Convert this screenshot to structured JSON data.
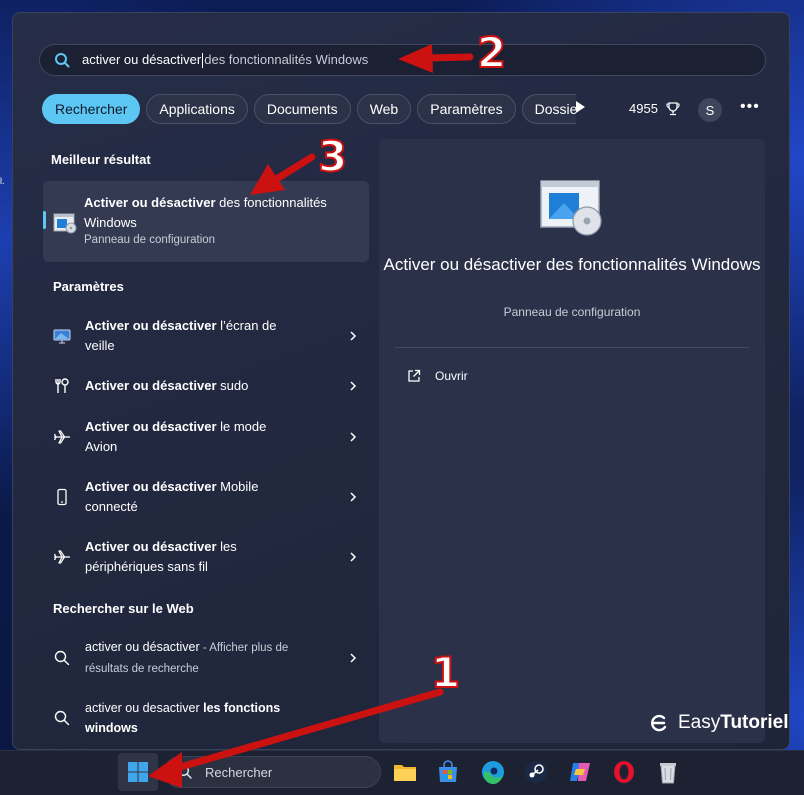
{
  "search": {
    "typed": "activer ou désactiver",
    "suggestion": "des fonctionnalités Windows"
  },
  "tabs": [
    {
      "label": "Rechercher",
      "active": true
    },
    {
      "label": "Applications",
      "active": false
    },
    {
      "label": "Documents",
      "active": false
    },
    {
      "label": "Web",
      "active": false
    },
    {
      "label": "Paramètres",
      "active": false
    },
    {
      "label": "Dossier",
      "active": false
    }
  ],
  "header": {
    "points": "4955",
    "avatar_initial": "S",
    "more_label": "•••"
  },
  "best_match": {
    "section_title": "Meilleur résultat",
    "title_bold": "Activer ou désactiver",
    "title_rest": " des fonctionnalités Windows",
    "subtitle": "Panneau de configuration"
  },
  "settings": {
    "section_title": "Paramètres",
    "items": [
      {
        "bold": "Activer ou désactiver",
        "rest": " l’écran de veille",
        "icon": "monitor-icon"
      },
      {
        "bold": "Activer ou désactiver",
        "rest": " sudo",
        "icon": "tools-icon"
      },
      {
        "bold": "Activer ou désactiver",
        "rest": " le mode Avion",
        "icon": "airplane-icon"
      },
      {
        "bold": "Activer ou désactiver",
        "rest": " Mobile connecté",
        "icon": "phone-icon"
      },
      {
        "bold": "Activer ou désactiver",
        "rest": " les périphériques sans fil",
        "icon": "airplane-icon"
      }
    ]
  },
  "web": {
    "section_title": "Rechercher sur le Web",
    "items": [
      {
        "normal": "activer ou désactiver",
        "muted": " - Afficher plus de résultats de recherche",
        "bold": ""
      },
      {
        "normal": "activer ou desactiver ",
        "muted": "",
        "bold": "les fonctions windows"
      }
    ]
  },
  "preview": {
    "title": "Activer ou désactiver des fonctionnalités Windows",
    "subtitle": "Panneau de configuration",
    "open_label": "Ouvrir"
  },
  "taskbar": {
    "search_label": "Rechercher",
    "apps": [
      "file-explorer-icon",
      "store-icon",
      "edge-icon",
      "steam-icon",
      "copilot-icon",
      "opera-icon",
      "recycle-bin-icon"
    ]
  },
  "watermark": {
    "prefix": "Easy",
    "suffix": "Tutoriel"
  },
  "annotations": [
    "1",
    "2",
    "3"
  ],
  "colors": {
    "accent": "#5cc7f2",
    "arrow": "#cc1111"
  }
}
